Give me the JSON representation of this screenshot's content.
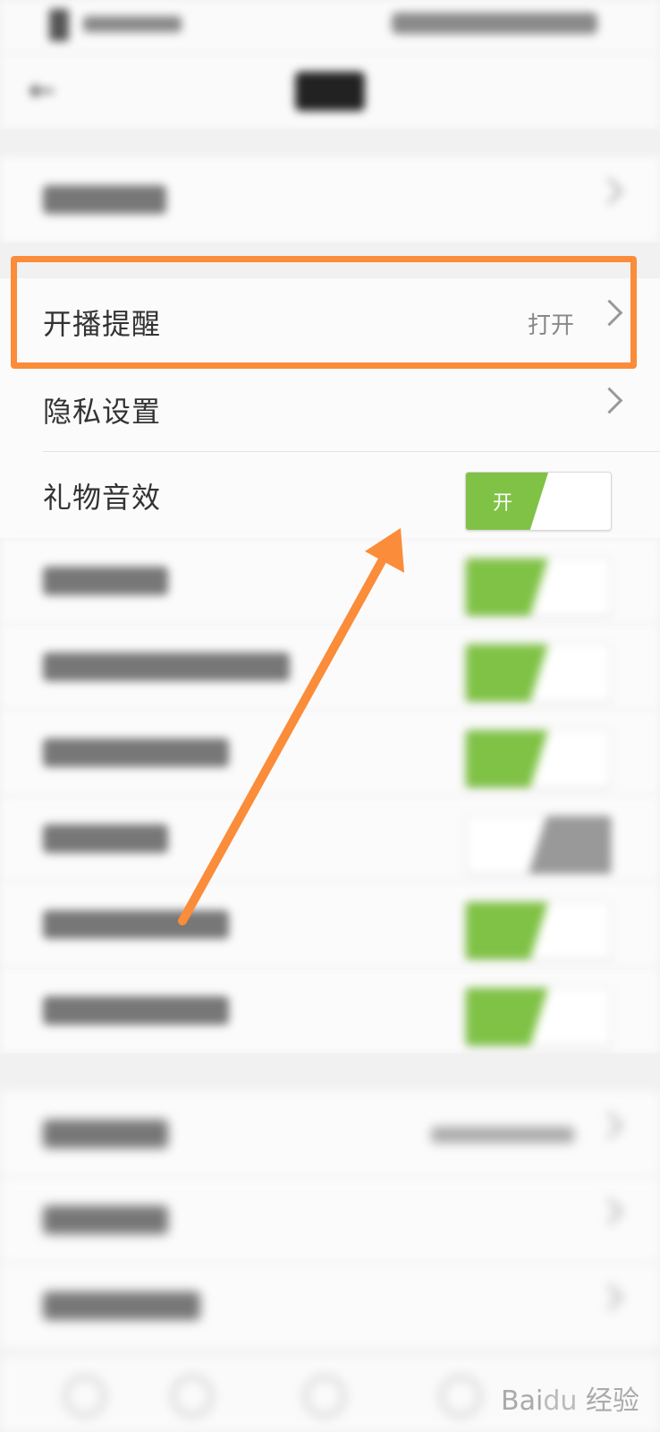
{
  "highlighted_row": {
    "label": "开播提醒",
    "value": "打开"
  },
  "privacy_row": {
    "label": "隐私设置"
  },
  "gift_sound_row": {
    "label": "礼物音效",
    "toggle_label": "开",
    "toggle_on": true
  },
  "colors": {
    "accent_green": "#7fc245",
    "highlight_orange": "#fb8c3a"
  },
  "icons": [
    "back-arrow-icon",
    "chevron-right-icon"
  ]
}
